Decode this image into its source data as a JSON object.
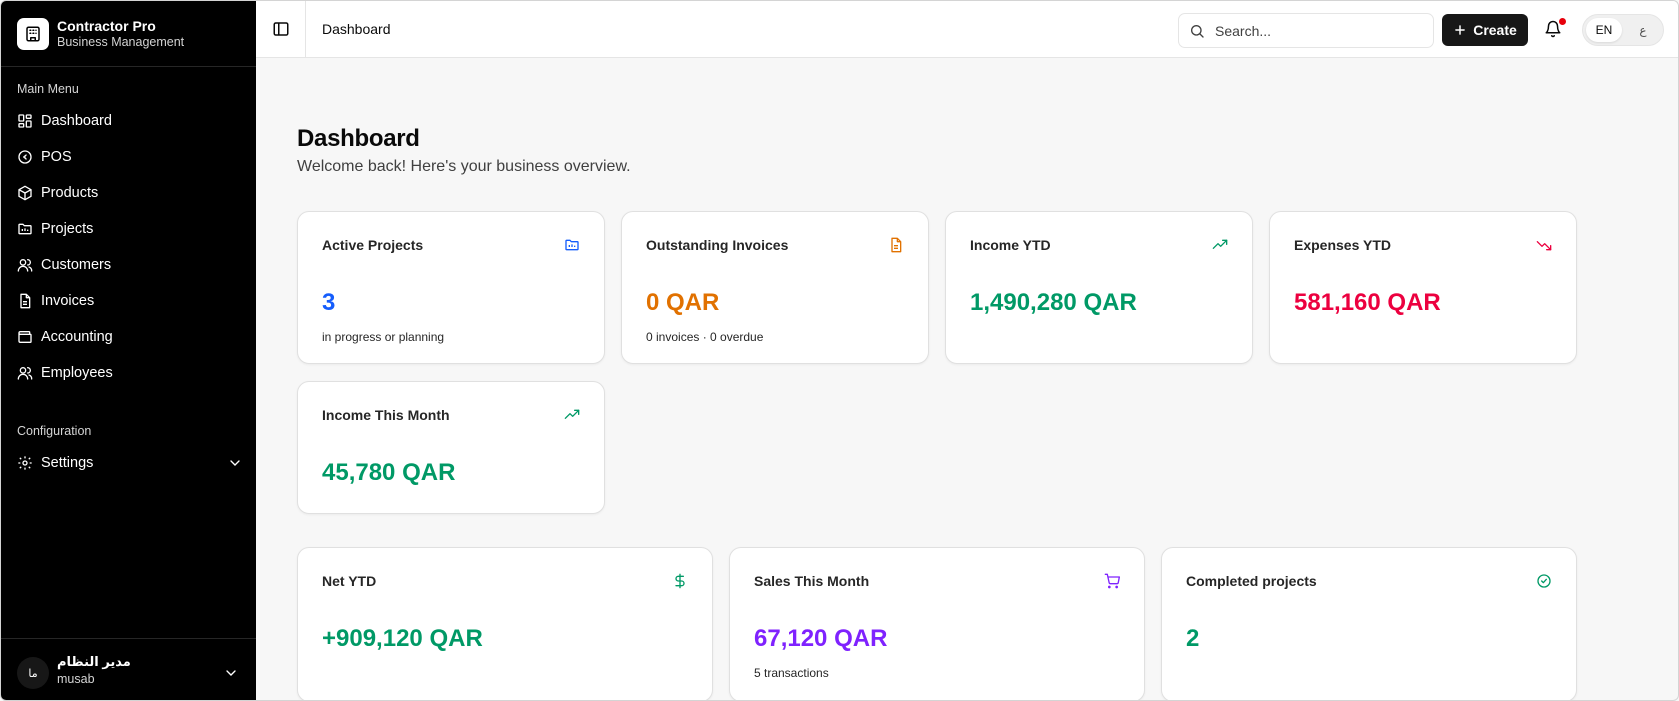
{
  "brand": {
    "name": "Contractor Pro",
    "subtitle": "Business Management"
  },
  "sidebar": {
    "main_menu_label": "Main Menu",
    "items": [
      {
        "label": "Dashboard",
        "icon": "dashboard-icon"
      },
      {
        "label": "POS",
        "icon": "pos-icon"
      },
      {
        "label": "Products",
        "icon": "package-icon"
      },
      {
        "label": "Projects",
        "icon": "folder-icon"
      },
      {
        "label": "Customers",
        "icon": "users-icon"
      },
      {
        "label": "Invoices",
        "icon": "file-icon"
      },
      {
        "label": "Accounting",
        "icon": "wallet-icon"
      },
      {
        "label": "Employees",
        "icon": "users-icon"
      }
    ],
    "config_label": "Configuration",
    "settings_label": "Settings"
  },
  "user": {
    "avatar": "ما",
    "name": "مدير النظام",
    "username": "musab"
  },
  "header": {
    "title": "Dashboard",
    "search_placeholder": "Search...",
    "create_label": "Create",
    "lang_en": "EN",
    "lang_ar": "ع"
  },
  "page": {
    "title": "Dashboard",
    "subtitle": "Welcome back! Here's your business overview."
  },
  "cards": [
    {
      "title": "Active Projects",
      "value": "3",
      "note": "in progress or planning",
      "color": "#155dfc",
      "icon": "folder-kanban-icon"
    },
    {
      "title": "Outstanding Invoices",
      "value": "0 QAR",
      "note": "0 invoices · 0 overdue",
      "color": "#e17100",
      "icon": "file-text-icon"
    },
    {
      "title": "Income YTD",
      "value": "1,490,280 QAR",
      "note": "",
      "color": "#009966",
      "icon": "trending-up-icon"
    },
    {
      "title": "Expenses YTD",
      "value": "581,160 QAR",
      "note": "",
      "color": "#ec003f",
      "icon": "trending-down-icon"
    },
    {
      "title": "Income This Month",
      "value": "45,780 QAR",
      "note": "",
      "color": "#009966",
      "icon": "trending-up-icon"
    },
    {
      "title": "Net YTD",
      "value": "+909,120 QAR",
      "note": "",
      "color": "#009966",
      "icon": "dollar-icon"
    },
    {
      "title": "Sales This Month",
      "value": "67,120 QAR",
      "note": "5 transactions",
      "color": "#7f22fe",
      "icon": "cart-icon"
    },
    {
      "title": "Completed projects",
      "value": "2",
      "note": "",
      "color": "#009966",
      "icon": "check-circle-icon"
    }
  ]
}
